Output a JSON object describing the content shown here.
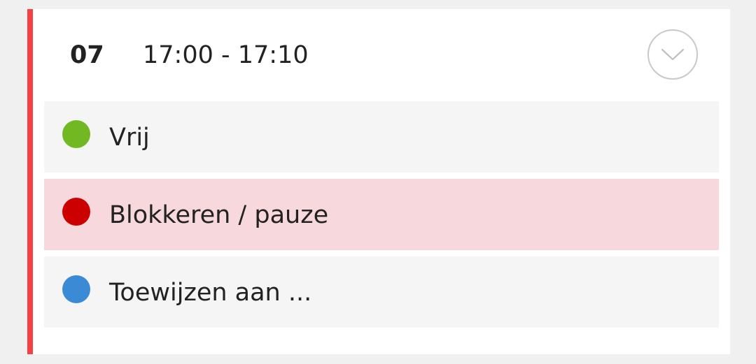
{
  "slot": {
    "number": "07",
    "time": "17:00 - 17:10",
    "accent_color": "#f44242",
    "toggle_icon": "chevron-down-icon"
  },
  "options": [
    {
      "label": "Vrij",
      "color": "#72b823",
      "selected": false
    },
    {
      "label": "Blokkeren / pauze",
      "color": "#cc0000",
      "selected": true
    },
    {
      "label": "Toewijzen aan ...",
      "color": "#3a8ad6",
      "selected": false
    }
  ]
}
